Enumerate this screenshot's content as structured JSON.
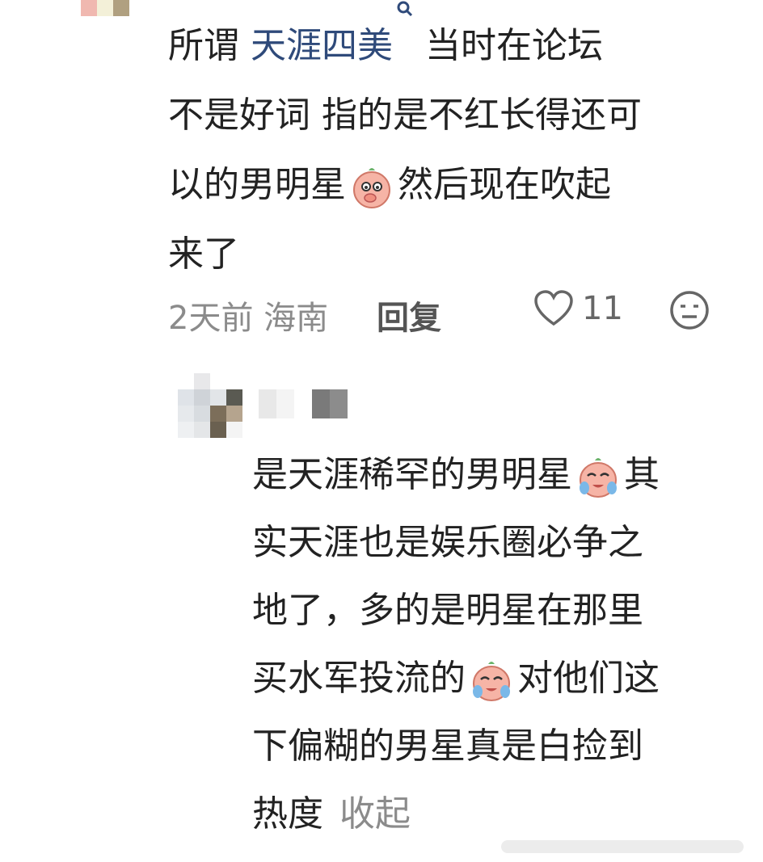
{
  "comment": {
    "prefix": "所谓",
    "link_text": "天涯四美",
    "line1_rest": "当时在论坛",
    "line2": "不是好词 指的是不红长得还可",
    "line3_a": "以的男明星",
    "line3_b": "然后现在吹起",
    "line4": "来了",
    "meta": {
      "time_location": "2天前 海南",
      "reply_label": "回复",
      "like_count": "11"
    },
    "icons": [
      "search-icon",
      "shy-face-emoji",
      "heart-icon",
      "neutral-face-icon"
    ]
  },
  "reply": {
    "line1": "是天涯稀罕的男明星",
    "line1_end": "其",
    "line2": "实天涯也是娱乐圈必争之",
    "line3": "地了，多的是明星在那里",
    "line4_a": "买水军投流的",
    "line4_b": "对他们这",
    "line5": "下偏糊的男星真是白捡到",
    "line6": "热度",
    "collapse_label": "收起",
    "icons": [
      "crying-face-emoji"
    ]
  },
  "colors": {
    "link": "#2f4a7a",
    "text": "#222222",
    "muted": "#8b8b8b"
  }
}
